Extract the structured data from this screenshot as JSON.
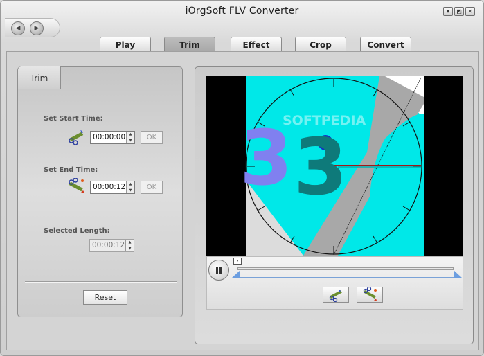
{
  "window": {
    "title": "iOrgSoft FLV Converter",
    "controls": [
      "▾",
      "◩",
      "✕"
    ]
  },
  "nav": {
    "back": "◀",
    "forward": "▶"
  },
  "tabs": [
    {
      "label": "Play"
    },
    {
      "label": "Trim"
    },
    {
      "label": "Effect"
    },
    {
      "label": "Crop"
    },
    {
      "label": "Convert"
    }
  ],
  "active_tab": "Trim",
  "trim": {
    "tab_label": "Trim",
    "start": {
      "label": "Set Start Time:",
      "value": "00:00:00",
      "ok": "OK"
    },
    "end": {
      "label": "Set End Time:",
      "value": "00:00:12",
      "ok": "OK"
    },
    "length": {
      "label": "Selected Length:",
      "value": "00:00:12"
    },
    "reset": "Reset"
  },
  "spinner": {
    "up": "▲",
    "down": "▼"
  },
  "player": {
    "watermark": "SOFTPEDIA",
    "countdown_digit": "3",
    "marker": "▾",
    "range_start": 0.0,
    "range_end": 1.0,
    "playhead": 0.0
  },
  "colors": {
    "active_tab": "#b1b1b1",
    "range": "#6c9ee0",
    "cyan": "#00ecec"
  }
}
